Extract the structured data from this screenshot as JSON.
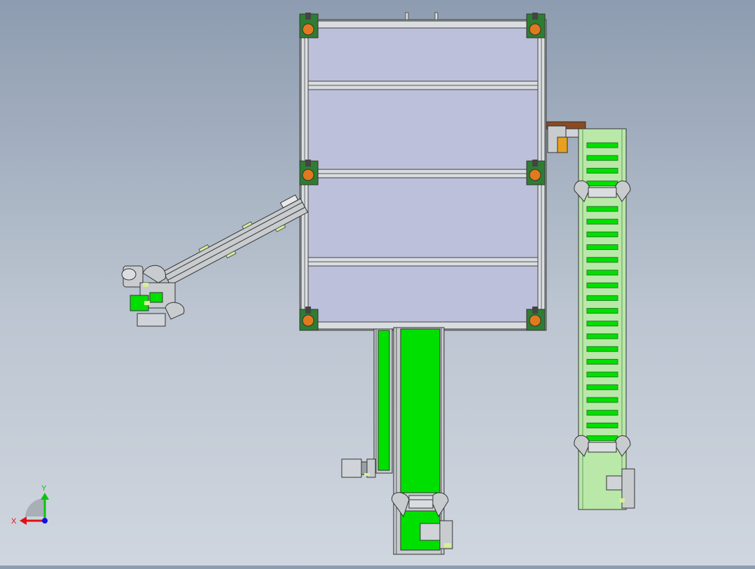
{
  "viewport": {
    "background_top": "#8d9cb0",
    "background_bottom": "#cfd6df"
  },
  "model": {
    "frame_panel_color": "#bcc0da",
    "frame_beam_color": "#7e858c",
    "belt_color": "#00e000",
    "cleat_belt_color": "#b9e8a8",
    "caster_color": "#e07a1e",
    "part_gray": "#c8cccf",
    "side_conveyor_cleats": 24
  },
  "triad": {
    "x_label": "X",
    "y_label": "Y",
    "x_color": "#e01010",
    "y_color": "#10c010",
    "z_color": "#1010e0"
  }
}
